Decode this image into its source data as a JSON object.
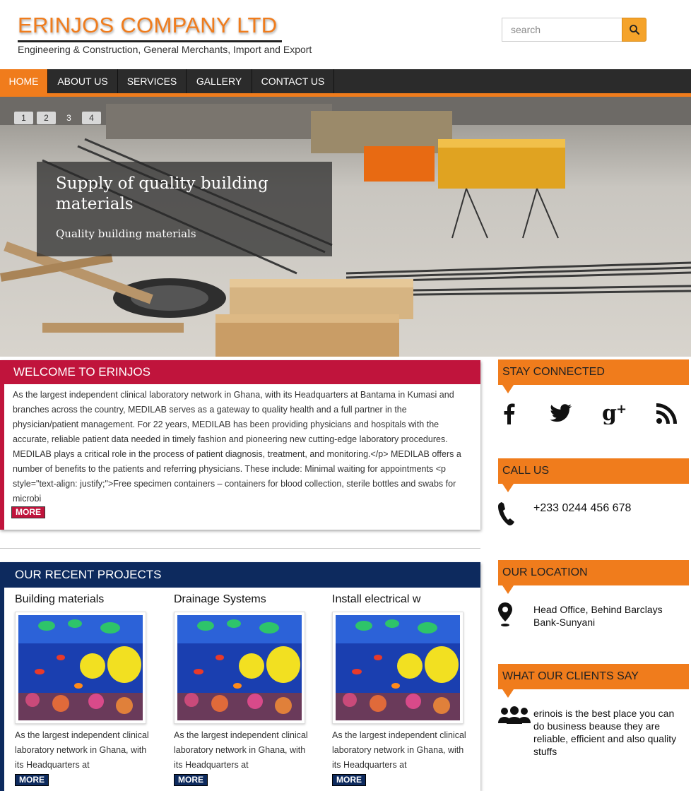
{
  "header": {
    "title": "ERINJOS COMPANY LTD",
    "tagline": "Engineering & Construction, General Merchants, Import and Export",
    "search_placeholder": "search"
  },
  "nav": {
    "items": [
      "HOME",
      "ABOUT US",
      "SERVICES",
      "GALLERY",
      "CONTACT US"
    ],
    "active": "HOME"
  },
  "slider": {
    "pager": [
      "1",
      "2",
      "3",
      "4"
    ],
    "active_page": "3",
    "caption_title": "Supply of quality building materials",
    "caption_subtitle": "Quality building materials"
  },
  "welcome": {
    "heading": "WELCOME TO ERINJOS",
    "text": "As the largest independent clinical laboratory network in Ghana, with its Headquarters at Bantama in Kumasi and branches across the country, MEDILAB serves as a gateway to quality health and a full partner in the physician/patient management. For 22 years, MEDILAB has been providing physicians and hospitals with the accurate, reliable patient data needed in timely fashion and pioneering new cutting-edge laboratory procedures. MEDILAB plays a critical role in the process of patient diagnosis, treatment, and monitoring.</p> MEDILAB offers a number of benefits to the patients and referring physicians. These include: Minimal waiting for appointments <p style=\"text-align: justify;\">Free specimen containers – containers for blood collection, sterile bottles and swabs for microbi",
    "more_label": "MORE"
  },
  "projects": {
    "heading": "OUR RECENT PROJECTS",
    "items": [
      {
        "title": "Building materials",
        "text": "As the largest independent clinical laboratory network in Ghana, with its Headquarters at",
        "more_label": "MORE"
      },
      {
        "title": "Drainage Systems",
        "text": "As the largest independent clinical laboratory network in Ghana, with its Headquarters at",
        "more_label": "MORE"
      },
      {
        "title": "Install electrical w",
        "text": "As the largest independent clinical laboratory network in Ghana, with its Headquarters at",
        "more_label": "MORE"
      }
    ]
  },
  "sidebar": {
    "stay_connected": "STAY CONNECTED",
    "social_icons": [
      "facebook-icon",
      "twitter-icon",
      "google-plus-icon",
      "rss-icon"
    ],
    "call_us": "CALL US",
    "phone": "+233 0244 456 678",
    "our_location": "OUR LOCATION",
    "address": "Head Office, Behind Barclays Bank-Sunyani",
    "clients_say": "WHAT OUR CLIENTS SAY",
    "testimonial": "erinois is the best place you can do business beause they are reliable, efficient and also quality stuffs"
  },
  "colors": {
    "orange": "#f07c1c",
    "crimson": "#c0143c",
    "navy": "#0d2a5e",
    "nav_dark": "#2b2b2b"
  }
}
